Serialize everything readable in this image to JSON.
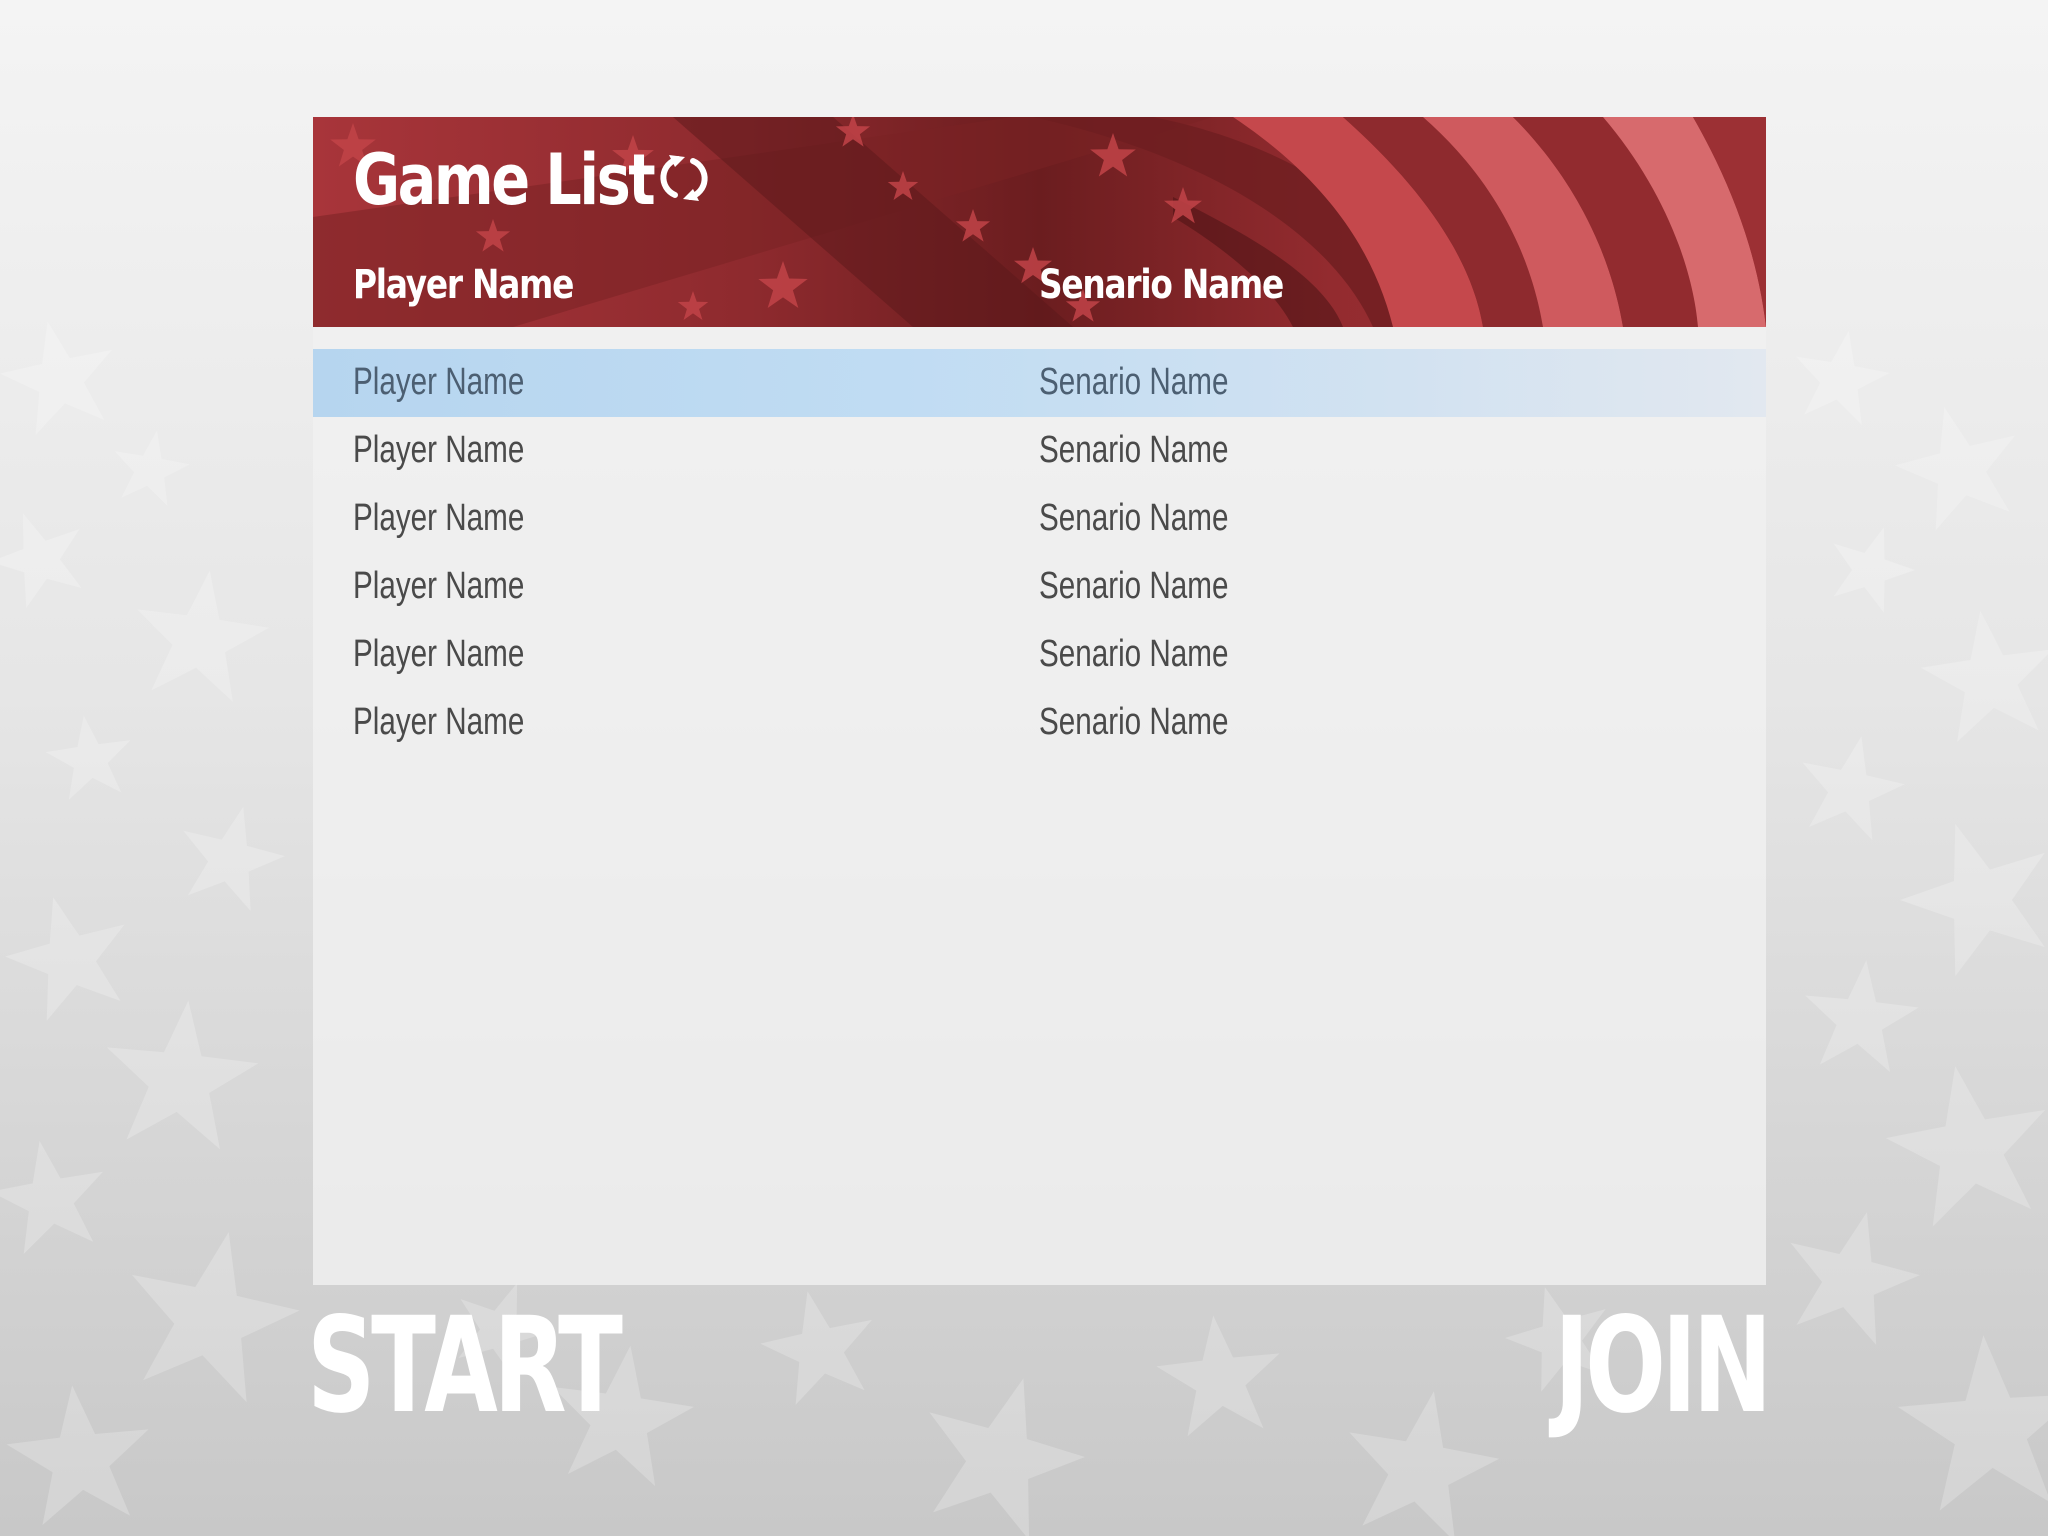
{
  "game_list": {
    "title": "Game List",
    "refresh_icon": "refresh-icon",
    "columns": {
      "player": "Player Name",
      "scenario": "Senario Name"
    },
    "rows": [
      {
        "player": "Player Name",
        "scenario": "Senario Name",
        "selected": true
      },
      {
        "player": "Player Name",
        "scenario": "Senario Name",
        "selected": false
      },
      {
        "player": "Player Name",
        "scenario": "Senario Name",
        "selected": false
      },
      {
        "player": "Player Name",
        "scenario": "Senario Name",
        "selected": false
      },
      {
        "player": "Player Name",
        "scenario": "Senario Name",
        "selected": false
      },
      {
        "player": "Player Name",
        "scenario": "Senario Name",
        "selected": false
      }
    ]
  },
  "actions": {
    "start_label": "START",
    "join_label": "JOIN"
  },
  "colors": {
    "header_red": "#a33236",
    "header_dark": "#6b1d1f",
    "selected_row": "#c0dcf3",
    "row_text": "#4a4a4a",
    "button_text": "#ffffff"
  }
}
